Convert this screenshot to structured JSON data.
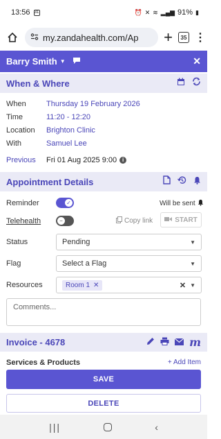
{
  "status_bar": {
    "time": "13:56",
    "notif_badge": "31",
    "battery": "91%"
  },
  "browser": {
    "url": "my.zandahealth.com/Ap",
    "tab_count": "35"
  },
  "header": {
    "patient_name": "Barry Smith"
  },
  "when_where": {
    "title": "When & Where",
    "rows": [
      {
        "label": "When",
        "value": "Thursday 19 February 2026"
      },
      {
        "label": "Time",
        "value": "11:20 - 12:20"
      },
      {
        "label": "Location",
        "value": "Brighton Clinic"
      },
      {
        "label": "With",
        "value": "Samuel Lee"
      }
    ],
    "previous_label": "Previous",
    "previous_value": "Fri 01 Aug 2025 9:00"
  },
  "appointment_details": {
    "title": "Appointment Details",
    "reminder_label": "Reminder",
    "reminder_on": true,
    "will_be_sent": "Will be sent",
    "telehealth_label": "Telehealth",
    "telehealth_on": false,
    "copy_link": "Copy link",
    "start": "START",
    "status_label": "Status",
    "status_value": "Pending",
    "flag_label": "Flag",
    "flag_placeholder": "Select a Flag",
    "resources_label": "Resources",
    "resource_chip": "Room 1",
    "comments_placeholder": "Comments..."
  },
  "invoice": {
    "title": "Invoice - 4678",
    "services_label": "Services & Products",
    "add_item": "+ Add Item"
  },
  "actions": {
    "save": "SAVE",
    "delete": "DELETE"
  },
  "colors": {
    "accent": "#5a55d2",
    "section_bg": "#eaeaf6",
    "link": "#4a46b8"
  }
}
